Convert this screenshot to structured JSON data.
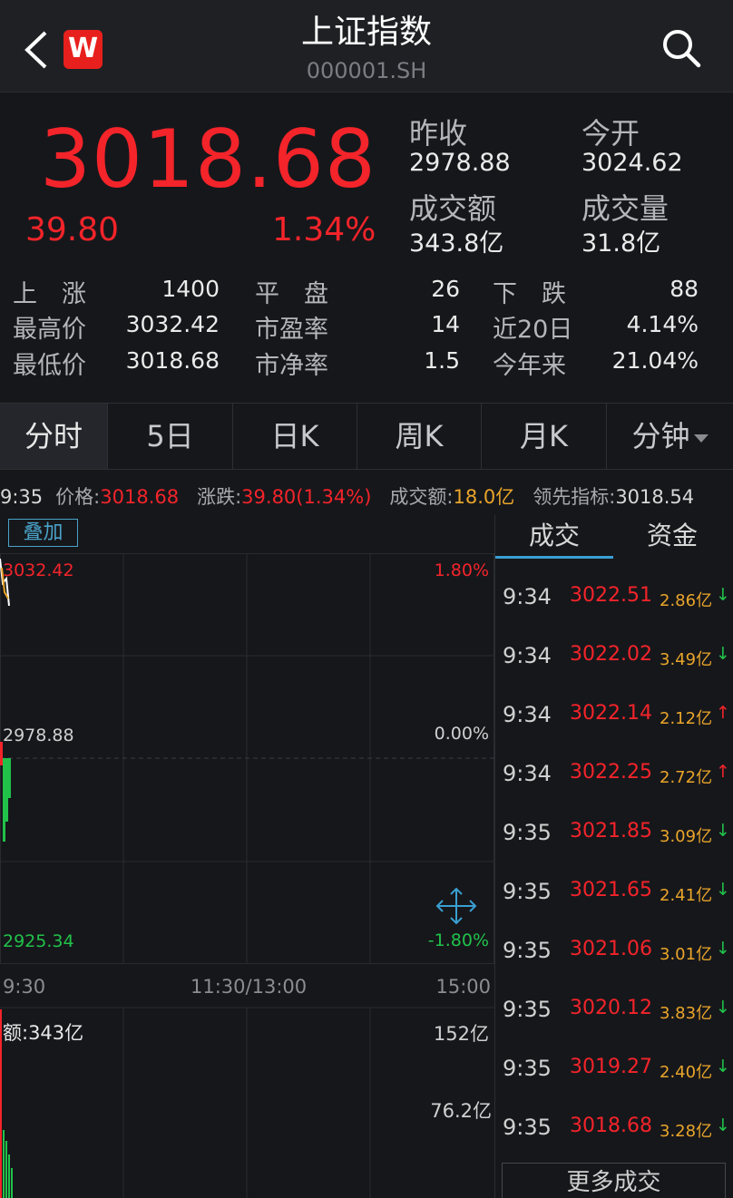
{
  "header": {
    "title": "上证指数",
    "code": "000001.SH",
    "logo_letter": "W"
  },
  "quote": {
    "price": "3018.68",
    "change": "39.80",
    "change_pct": "1.34%",
    "prev_close_label": "昨收",
    "prev_close": "2978.88",
    "open_label": "今开",
    "open": "3024.62",
    "turnover_label": "成交额",
    "turnover": "343.8亿",
    "volume_label": "成交量",
    "volume": "31.8亿"
  },
  "stats": {
    "up_label": "上　涨",
    "up": "1400",
    "flat_label": "平　盘",
    "flat": "26",
    "down_label": "下　跌",
    "down": "88",
    "high_label": "最高价",
    "high": "3032.42",
    "pe_label": "市盈率",
    "pe": "14",
    "d20_label": "近20日",
    "d20": "4.14%",
    "low_label": "最低价",
    "low": "3018.68",
    "pb_label": "市净率",
    "pb": "1.5",
    "ytd_label": "今年来",
    "ytd": "21.04%"
  },
  "tabs": [
    "分时",
    "5日",
    "日K",
    "周K",
    "月K",
    "分钟"
  ],
  "infobar": {
    "time": "9:35",
    "price_label": "价格:",
    "price": "3018.68",
    "chg_label": "涨跌:",
    "chg": "39.80(1.34%)",
    "amt_label": "成交额:",
    "amt": "18.0亿",
    "lead_label": "领先指标:",
    "lead": "3018.54"
  },
  "chart": {
    "overlay_label": "叠加",
    "y_top": "3032.42",
    "y_top_pct": "1.80%",
    "y_mid": "2978.88",
    "y_mid_pct": "0.00%",
    "y_bot": "2925.34",
    "y_bot_pct": "-1.80%",
    "x_start": "9:30",
    "x_mid": "11:30/13:00",
    "x_end": "15:00",
    "vol_label": "额:343亿",
    "vol_top": "152亿",
    "vol_mid": "76.2亿",
    "colors": {
      "up": "#f3242a",
      "down": "#21c24a",
      "line": "#ffffff",
      "avg": "#e9a52a",
      "grid": "#2a2b2f"
    }
  },
  "panel": {
    "tabs": [
      "成交",
      "资金"
    ],
    "trades": [
      {
        "time": "9:34",
        "price": "3022.51",
        "amount": "2.86亿",
        "dir": "down"
      },
      {
        "time": "9:34",
        "price": "3022.02",
        "amount": "3.49亿",
        "dir": "down"
      },
      {
        "time": "9:34",
        "price": "3022.14",
        "amount": "2.12亿",
        "dir": "up"
      },
      {
        "time": "9:34",
        "price": "3022.25",
        "amount": "2.72亿",
        "dir": "up"
      },
      {
        "time": "9:35",
        "price": "3021.85",
        "amount": "3.09亿",
        "dir": "down"
      },
      {
        "time": "9:35",
        "price": "3021.65",
        "amount": "2.41亿",
        "dir": "down"
      },
      {
        "time": "9:35",
        "price": "3021.06",
        "amount": "3.01亿",
        "dir": "down"
      },
      {
        "time": "9:35",
        "price": "3020.12",
        "amount": "3.83亿",
        "dir": "down"
      },
      {
        "time": "9:35",
        "price": "3019.27",
        "amount": "2.40亿",
        "dir": "down"
      },
      {
        "time": "9:35",
        "price": "3018.68",
        "amount": "3.28亿",
        "dir": "down"
      }
    ],
    "more_label": "更多成交"
  }
}
